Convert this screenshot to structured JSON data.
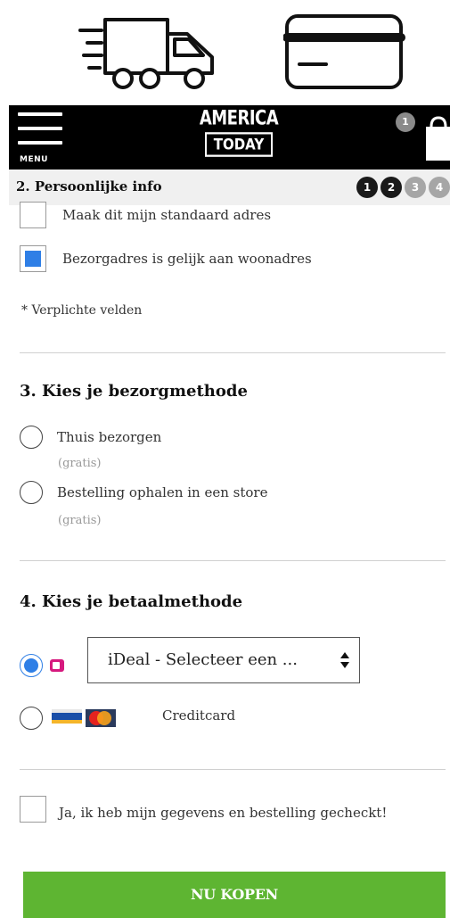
{
  "header": {
    "menu_label": "MENU",
    "logo_line1": "AMERICA",
    "logo_line2": "TODAY",
    "cart_count": "1"
  },
  "progress": {
    "title": "2. Persoonlijke info",
    "steps": [
      "1",
      "2",
      "3",
      "4"
    ]
  },
  "address": {
    "default_label": "Maak dit mijn standaard adres",
    "default_checked": false,
    "same_address_label": "Bezorgadres is gelijk aan woonadres",
    "same_address_checked": true,
    "required_note": "* Verplichte velden"
  },
  "delivery": {
    "title": "3. Kies je bezorgmethode",
    "options": [
      {
        "label": "Thuis bezorgen",
        "sub": "(gratis)",
        "selected": false
      },
      {
        "label": "Bestelling ophalen in een store",
        "sub": "(gratis)",
        "selected": false
      }
    ]
  },
  "payment": {
    "title": "4. Kies je betaalmethode",
    "ideal_select_value": "iDeal - Selecteer een ...",
    "ideal_selected": true,
    "creditcard_label": "Creditcard",
    "creditcard_selected": false
  },
  "confirm": {
    "label": "Ja, ik heb mijn gegevens en bestelling gecheckt!",
    "checked": false
  },
  "buy_button": "NU KOPEN",
  "colors": {
    "accent_blue": "#2f7fe6",
    "buy_green": "#5eb532",
    "header_black": "#000000",
    "ideal_pink": "#d6197e"
  }
}
